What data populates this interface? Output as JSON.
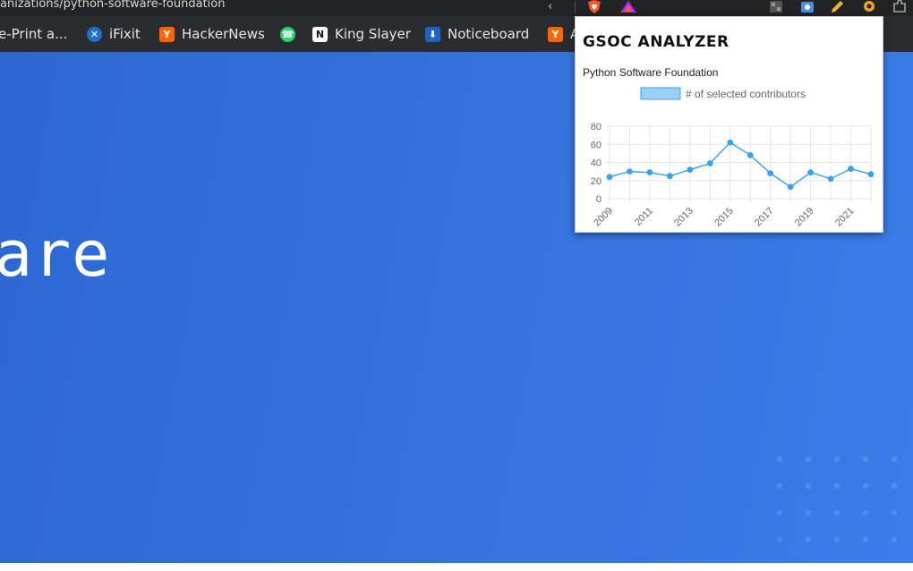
{
  "browser": {
    "url_fragment": "anizations/python-software-foundation",
    "share_icon": "share-icon",
    "extensions": [
      {
        "name": "brave-shield-icon",
        "color": "#fb542b"
      },
      {
        "name": "brave-rewards-icon",
        "color": "#ac2ce8"
      },
      {
        "name": "qr-code-icon",
        "color": "#888888"
      },
      {
        "name": "camera-extension-icon",
        "color": "#4a90e2"
      },
      {
        "name": "pencil-extension-icon",
        "color": "#f0b429"
      },
      {
        "name": "gear-extension-icon",
        "color": "#f0a020"
      },
      {
        "name": "puzzle-icon",
        "color": "#bbbbbb"
      }
    ]
  },
  "bookmarks": [
    {
      "label": "e-Print a...",
      "icon": "none"
    },
    {
      "label": "iFixit",
      "icon": "ifixit-icon"
    },
    {
      "label": "HackerNews",
      "icon": "hackernews-icon"
    },
    {
      "label": "",
      "icon": "whatsapp-icon"
    },
    {
      "label": "King Slayer",
      "icon": "notion-icon"
    },
    {
      "label": "Noticeboard",
      "icon": "noticeboard-icon"
    },
    {
      "label": "A",
      "icon": "hackernews-icon"
    }
  ],
  "page": {
    "hero_text": "are"
  },
  "popup": {
    "title": "GSOC ANALYZER",
    "org_name": "Python Software Foundation"
  },
  "chart_data": {
    "type": "line",
    "legend": "# of selected contributors",
    "x": [
      "2009",
      "2010",
      "2011",
      "2012",
      "2013",
      "2014",
      "2015",
      "2016",
      "2017",
      "2018",
      "2019",
      "2020",
      "2021",
      "2022"
    ],
    "x_tick_labels": [
      "2009",
      "2011",
      "2013",
      "2015",
      "2017",
      "2019",
      "2021"
    ],
    "series": [
      {
        "name": "# of selected contributors",
        "values": [
          24,
          30,
          29,
          25,
          32,
          39,
          62,
          48,
          28,
          13,
          29,
          22,
          33,
          27
        ]
      }
    ],
    "ylim": [
      0,
      80
    ],
    "y_ticks": [
      0,
      20,
      40,
      60,
      80
    ],
    "color": "#36a2eb",
    "fill_color": "#9ad0f5",
    "grid": true,
    "legend_position": "top"
  }
}
